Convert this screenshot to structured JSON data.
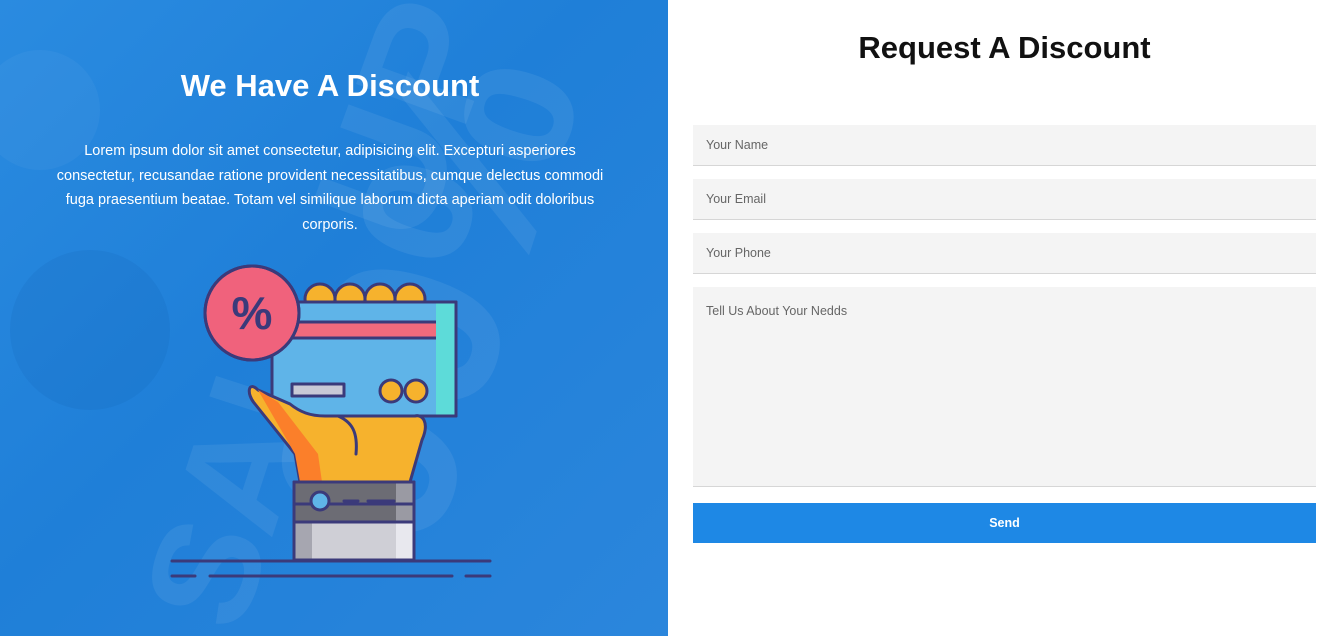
{
  "offer": {
    "title": "We Have A Discount",
    "description": "Lorem ipsum dolor sit amet consectetur, adipisicing elit. Excepturi asperiores consectetur, recusandae ratione provident necessitatibus, cumque delectus commodi fuga praesentium beatae. Totam vel similique laborum dicta aperiam odit doloribus corporis.",
    "illustration_icon": "hand-holding-discount-card-icon",
    "badge_symbol": "%",
    "background_watermark": [
      "UPTO",
      "00%",
      "SAL"
    ]
  },
  "form": {
    "title": "Request A Discount",
    "name_placeholder": "Your Name",
    "email_placeholder": "Your Email",
    "phone_placeholder": "Your Phone",
    "needs_placeholder": "Tell Us About Your Nedds",
    "send_label": "Send"
  },
  "colors": {
    "panel_blue": "#1f7fd8",
    "button_blue": "#1e88e5",
    "field_bg": "#f4f4f4"
  }
}
